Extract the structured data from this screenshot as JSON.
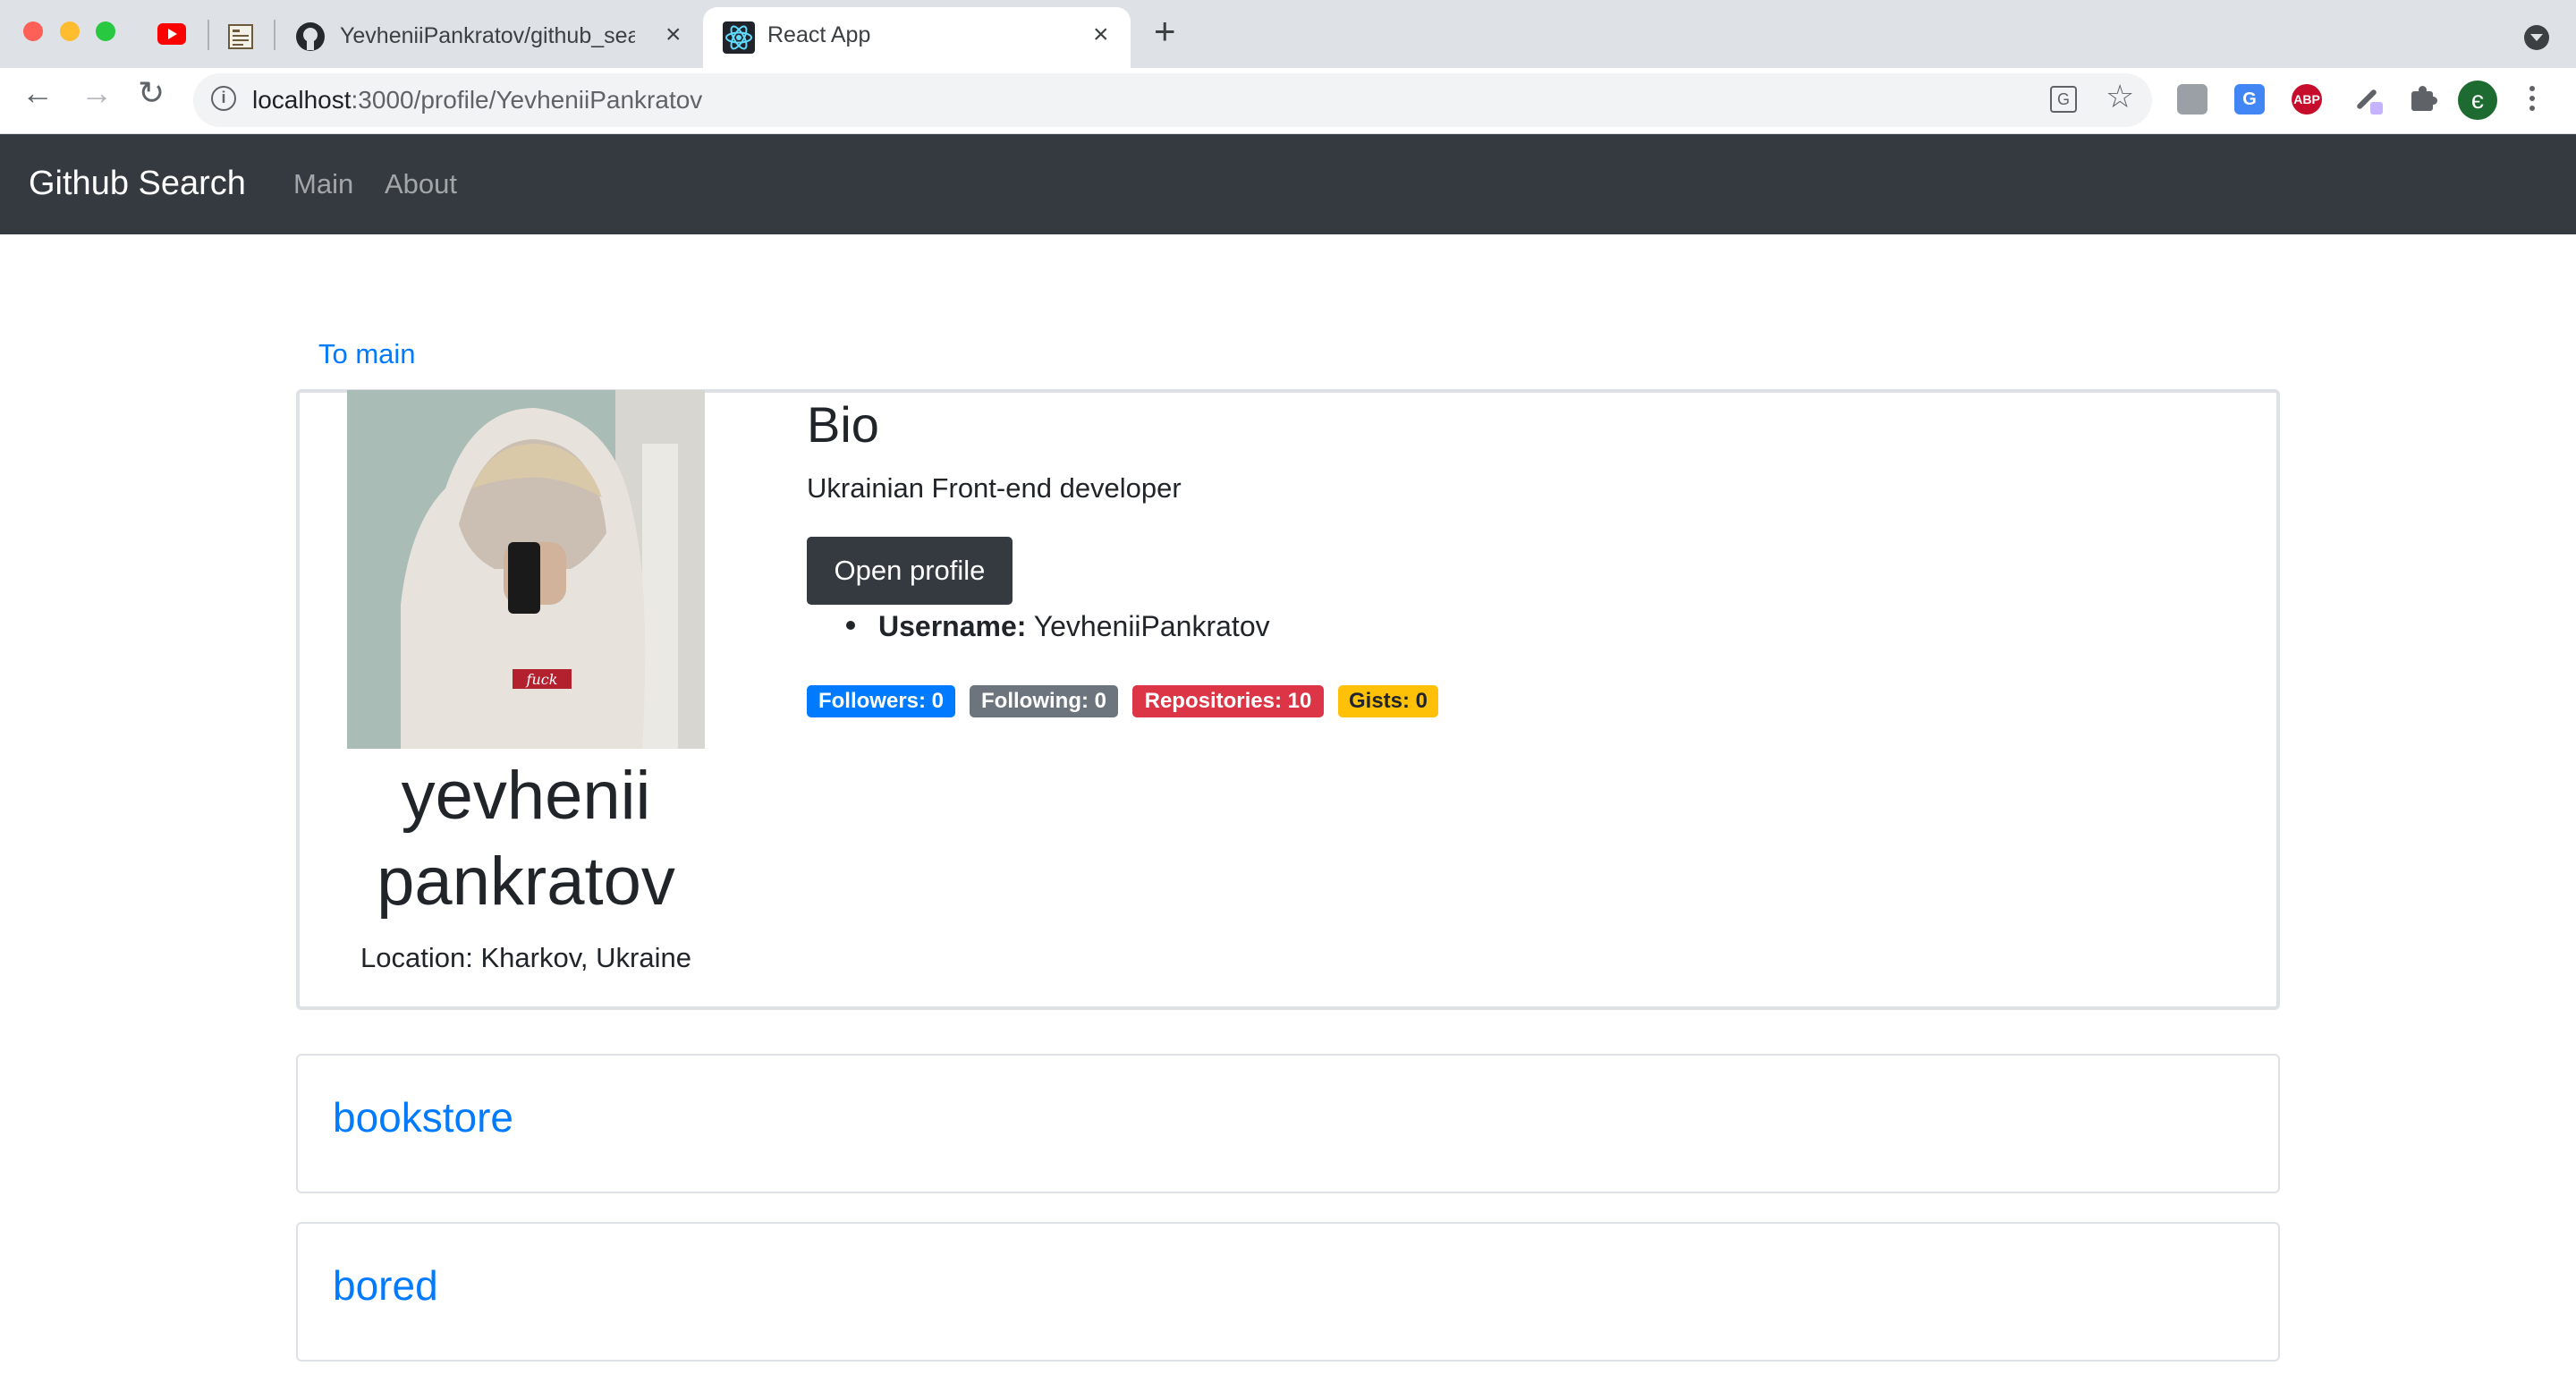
{
  "browser": {
    "tabs": [
      {
        "title": "YevheniiPankratov/github_sear"
      },
      {
        "title": "React App"
      }
    ],
    "url_host": "localhost",
    "url_path": ":3000/profile/YevheniiPankratov",
    "profile_initial": "є"
  },
  "navbar": {
    "brand": "Github Search",
    "links": [
      "Main",
      "About"
    ]
  },
  "profile": {
    "back_link": "To main",
    "name": "yevhenii pankratov",
    "location": "Location: Kharkov, Ukraine",
    "bio_heading": "Bio",
    "bio_text": "Ukrainian Front-end developer",
    "open_button": "Open profile",
    "username_label": "Username:",
    "username_value": "YevheniiPankratov",
    "avatar_print": "fuck",
    "badges": [
      {
        "label": "Followers: 0",
        "color": "#007bff"
      },
      {
        "label": "Following: 0",
        "color": "#6c757d"
      },
      {
        "label": "Repositories: 10",
        "color": "#dc3545"
      },
      {
        "label": "Gists: 0",
        "color": "#ffc107"
      }
    ]
  },
  "repos": [
    {
      "name": "bookstore"
    },
    {
      "name": "bored"
    }
  ]
}
